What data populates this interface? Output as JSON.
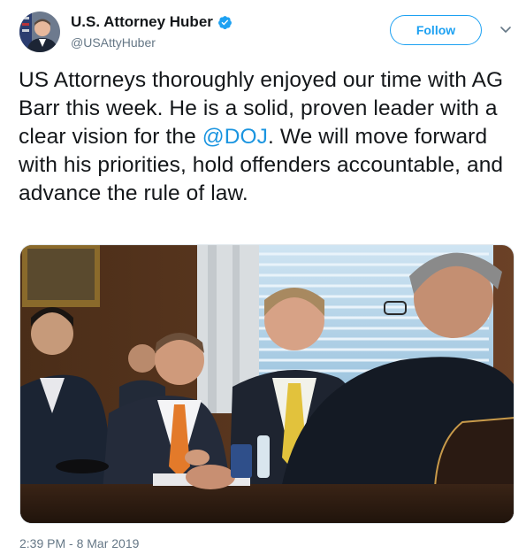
{
  "author": {
    "display_name": "U.S. Attorney Huber",
    "handle": "@USAttyHuber",
    "verified": true,
    "avatar_icon": "avatar",
    "verified_icon": "verified-badge-icon"
  },
  "actions": {
    "follow_label": "Follow",
    "more_icon": "chevron-down-icon"
  },
  "tweet": {
    "text_before": "US Attorneys thoroughly enjoyed our time with AG Barr this week. He is a solid, proven leader with a clear vision for the ",
    "mention": "@DOJ",
    "text_after": ".  We will move forward with his priorities, hold offenders accountable, and advance the rule of law.",
    "timestamp": "2:39 PM - 8 Mar 2019"
  },
  "colors": {
    "link": "#1b95e0",
    "accent": "#1da1f2",
    "secondary_text": "#657786"
  }
}
